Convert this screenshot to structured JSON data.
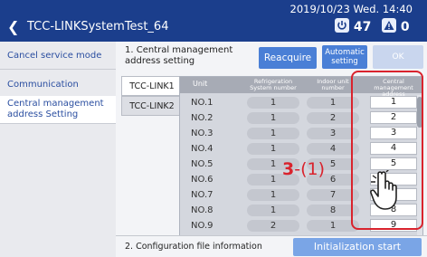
{
  "header": {
    "back_icon": "chevron-left-icon",
    "title": "TCC-LINKSystemTest_64",
    "datetime": "2019/10/23 Wed. 14:40",
    "power_count": "47",
    "alert_count": "0",
    "background_color": "#1b3e8c"
  },
  "sidebar": {
    "items": [
      {
        "label": "Cancel service mode",
        "active": false
      },
      {
        "label": "Communication",
        "active": false
      },
      {
        "label": "Central management address Setting",
        "active": true
      }
    ]
  },
  "main": {
    "section_title": "1. Central management address setting",
    "buttons": {
      "reacquire": "Reacquire",
      "automatic_setting": "Automatic setting",
      "ok": "OK"
    },
    "tabs": [
      "TCC-LINK1",
      "TCC-LINK2"
    ],
    "table": {
      "headers": [
        "Unit",
        "Refrigeration System number",
        "Indoor unit number",
        "Central management address"
      ],
      "rows": [
        {
          "unit": "NO.1",
          "refrigeration": "1",
          "indoor": "1",
          "address": "1"
        },
        {
          "unit": "NO.2",
          "refrigeration": "1",
          "indoor": "2",
          "address": "2"
        },
        {
          "unit": "NO.3",
          "refrigeration": "1",
          "indoor": "3",
          "address": "3"
        },
        {
          "unit": "NO.4",
          "refrigeration": "1",
          "indoor": "4",
          "address": "4"
        },
        {
          "unit": "NO.5",
          "refrigeration": "1",
          "indoor": "5",
          "address": "5"
        },
        {
          "unit": "NO.6",
          "refrigeration": "1",
          "indoor": "6",
          "address": ""
        },
        {
          "unit": "NO.7",
          "refrigeration": "1",
          "indoor": "7",
          "address": ""
        },
        {
          "unit": "NO.8",
          "refrigeration": "1",
          "indoor": "8",
          "address": "8"
        },
        {
          "unit": "NO.9",
          "refrigeration": "2",
          "indoor": "1",
          "address": "9"
        }
      ]
    },
    "annotation": {
      "step": "3",
      "sub": "-(1)"
    }
  },
  "footer": {
    "section_title": "2. Configuration file information",
    "init_button": "Initialization start"
  },
  "colors": {
    "accent_blue": "#4a7fd6",
    "highlight_red": "#d9232d"
  }
}
